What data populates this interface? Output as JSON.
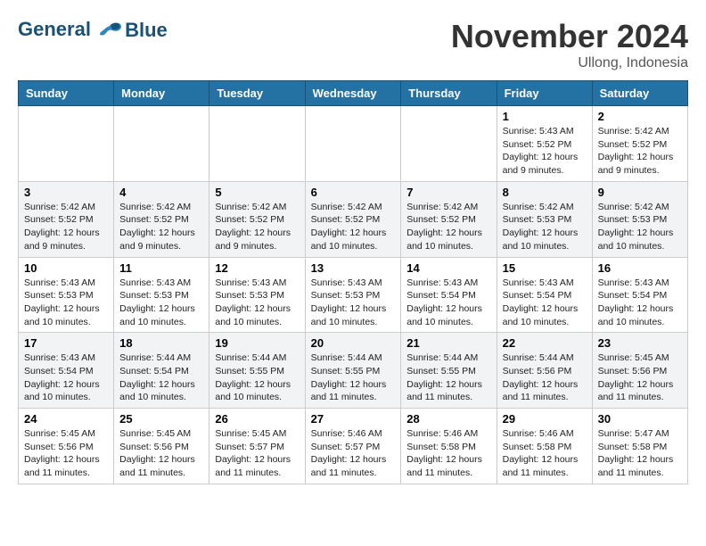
{
  "header": {
    "logo_line1": "General",
    "logo_line2": "Blue",
    "month": "November 2024",
    "location": "Ullong, Indonesia"
  },
  "days_of_week": [
    "Sunday",
    "Monday",
    "Tuesday",
    "Wednesday",
    "Thursday",
    "Friday",
    "Saturday"
  ],
  "weeks": [
    [
      {
        "day": "",
        "info": ""
      },
      {
        "day": "",
        "info": ""
      },
      {
        "day": "",
        "info": ""
      },
      {
        "day": "",
        "info": ""
      },
      {
        "day": "",
        "info": ""
      },
      {
        "day": "1",
        "info": "Sunrise: 5:43 AM\nSunset: 5:52 PM\nDaylight: 12 hours and 9 minutes."
      },
      {
        "day": "2",
        "info": "Sunrise: 5:42 AM\nSunset: 5:52 PM\nDaylight: 12 hours and 9 minutes."
      }
    ],
    [
      {
        "day": "3",
        "info": "Sunrise: 5:42 AM\nSunset: 5:52 PM\nDaylight: 12 hours and 9 minutes."
      },
      {
        "day": "4",
        "info": "Sunrise: 5:42 AM\nSunset: 5:52 PM\nDaylight: 12 hours and 9 minutes."
      },
      {
        "day": "5",
        "info": "Sunrise: 5:42 AM\nSunset: 5:52 PM\nDaylight: 12 hours and 9 minutes."
      },
      {
        "day": "6",
        "info": "Sunrise: 5:42 AM\nSunset: 5:52 PM\nDaylight: 12 hours and 10 minutes."
      },
      {
        "day": "7",
        "info": "Sunrise: 5:42 AM\nSunset: 5:52 PM\nDaylight: 12 hours and 10 minutes."
      },
      {
        "day": "8",
        "info": "Sunrise: 5:42 AM\nSunset: 5:53 PM\nDaylight: 12 hours and 10 minutes."
      },
      {
        "day": "9",
        "info": "Sunrise: 5:42 AM\nSunset: 5:53 PM\nDaylight: 12 hours and 10 minutes."
      }
    ],
    [
      {
        "day": "10",
        "info": "Sunrise: 5:43 AM\nSunset: 5:53 PM\nDaylight: 12 hours and 10 minutes."
      },
      {
        "day": "11",
        "info": "Sunrise: 5:43 AM\nSunset: 5:53 PM\nDaylight: 12 hours and 10 minutes."
      },
      {
        "day": "12",
        "info": "Sunrise: 5:43 AM\nSunset: 5:53 PM\nDaylight: 12 hours and 10 minutes."
      },
      {
        "day": "13",
        "info": "Sunrise: 5:43 AM\nSunset: 5:53 PM\nDaylight: 12 hours and 10 minutes."
      },
      {
        "day": "14",
        "info": "Sunrise: 5:43 AM\nSunset: 5:54 PM\nDaylight: 12 hours and 10 minutes."
      },
      {
        "day": "15",
        "info": "Sunrise: 5:43 AM\nSunset: 5:54 PM\nDaylight: 12 hours and 10 minutes."
      },
      {
        "day": "16",
        "info": "Sunrise: 5:43 AM\nSunset: 5:54 PM\nDaylight: 12 hours and 10 minutes."
      }
    ],
    [
      {
        "day": "17",
        "info": "Sunrise: 5:43 AM\nSunset: 5:54 PM\nDaylight: 12 hours and 10 minutes."
      },
      {
        "day": "18",
        "info": "Sunrise: 5:44 AM\nSunset: 5:54 PM\nDaylight: 12 hours and 10 minutes."
      },
      {
        "day": "19",
        "info": "Sunrise: 5:44 AM\nSunset: 5:55 PM\nDaylight: 12 hours and 10 minutes."
      },
      {
        "day": "20",
        "info": "Sunrise: 5:44 AM\nSunset: 5:55 PM\nDaylight: 12 hours and 11 minutes."
      },
      {
        "day": "21",
        "info": "Sunrise: 5:44 AM\nSunset: 5:55 PM\nDaylight: 12 hours and 11 minutes."
      },
      {
        "day": "22",
        "info": "Sunrise: 5:44 AM\nSunset: 5:56 PM\nDaylight: 12 hours and 11 minutes."
      },
      {
        "day": "23",
        "info": "Sunrise: 5:45 AM\nSunset: 5:56 PM\nDaylight: 12 hours and 11 minutes."
      }
    ],
    [
      {
        "day": "24",
        "info": "Sunrise: 5:45 AM\nSunset: 5:56 PM\nDaylight: 12 hours and 11 minutes."
      },
      {
        "day": "25",
        "info": "Sunrise: 5:45 AM\nSunset: 5:56 PM\nDaylight: 12 hours and 11 minutes."
      },
      {
        "day": "26",
        "info": "Sunrise: 5:45 AM\nSunset: 5:57 PM\nDaylight: 12 hours and 11 minutes."
      },
      {
        "day": "27",
        "info": "Sunrise: 5:46 AM\nSunset: 5:57 PM\nDaylight: 12 hours and 11 minutes."
      },
      {
        "day": "28",
        "info": "Sunrise: 5:46 AM\nSunset: 5:58 PM\nDaylight: 12 hours and 11 minutes."
      },
      {
        "day": "29",
        "info": "Sunrise: 5:46 AM\nSunset: 5:58 PM\nDaylight: 12 hours and 11 minutes."
      },
      {
        "day": "30",
        "info": "Sunrise: 5:47 AM\nSunset: 5:58 PM\nDaylight: 12 hours and 11 minutes."
      }
    ]
  ]
}
